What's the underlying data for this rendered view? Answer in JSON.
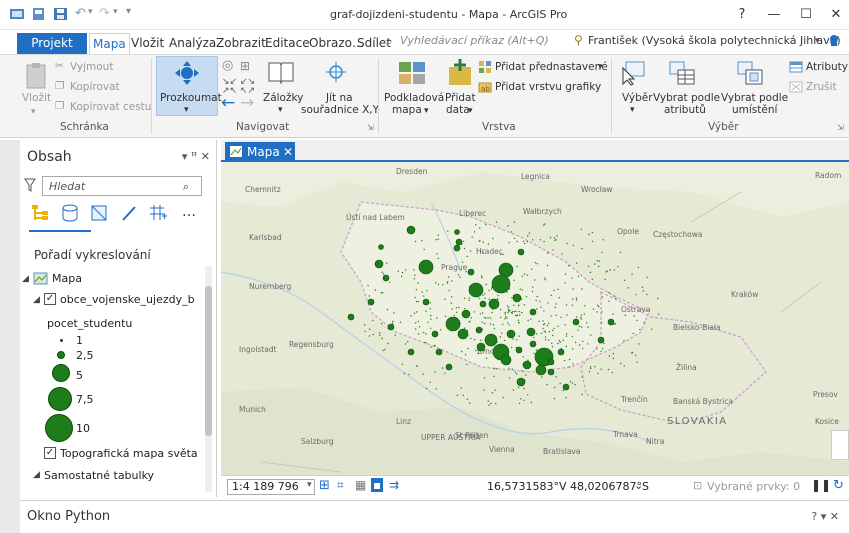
{
  "window": {
    "title": "graf-dojizdeni-studentu - Mapa - ArcGIS Pro",
    "help": "?",
    "minimize": "—",
    "maximize": "☐",
    "close": "✕"
  },
  "tabs": [
    "Projekt",
    "Mapa",
    "Vložit",
    "Analýza",
    "Zobrazit",
    "Editace",
    "Obrazo…",
    "Sdílet"
  ],
  "command_search": {
    "placeholder": "Vyhledávací příkaz (Alt+Q)"
  },
  "user": "František (Vysoká škola polytechnická Jihlava)",
  "ribbon": {
    "clipboard": {
      "paste": "Vložit",
      "cut": "Vyjmout",
      "copy": "Kopírovat",
      "copy_path": "Kopírovat cestu",
      "group": "Schránka"
    },
    "navigate": {
      "explore": "Prozkoumat",
      "bookmarks": "Záložky",
      "goto_xy_1": "Jít na",
      "goto_xy_2": "souřadnice X,Y",
      "group": "Navigovat"
    },
    "layer": {
      "basemap_1": "Podkladová",
      "basemap_2": "mapa",
      "add_data_1": "Přidat",
      "add_data_2": "data",
      "add_preset": "Přidat přednastavené",
      "add_graphics": "Přidat vrstvu grafiky",
      "group": "Vrstva"
    },
    "selection": {
      "select": "Výběr",
      "by_attr_1": "Vybrat podle",
      "by_attr_2": "atributů",
      "by_loc_1": "Vybrat podle",
      "by_loc_2": "umístění",
      "attributes": "Atributy",
      "clear": "Zrušit",
      "group": "Výběr"
    }
  },
  "contents": {
    "title": "Obsah",
    "controls": "▾ ꟸ ✕",
    "search_placeholder": "Hledat",
    "draw_order": "Pořadí vykreslování",
    "map_name": "Mapa",
    "layer_name": "obce_vojenske_ujezdy_b",
    "field": "pocet_studentu",
    "legend": [
      "1",
      "2,5",
      "5",
      "7,5",
      "10"
    ],
    "basemap": "Topografická mapa světa",
    "standalone": "Samostatné tabulky"
  },
  "map_view": {
    "tab": "Mapa",
    "scale": "1:4 189 796",
    "coords": "16,5731583°V 48,0206787°S",
    "selected": "Vybrané prvky: 0",
    "labels": [
      "Dresden",
      "Chemnitz",
      "Legnica",
      "Wrocław",
      "Ústí nad Labem",
      "Liberec",
      "Wałbrzych",
      "Opole",
      "Częstochowa",
      "Karlsbad",
      "Prague",
      "Hradec",
      "Kraków",
      "Nuremberg",
      "Regensburg",
      "Ostrava",
      "Bielsko-Biała",
      "Ingolstadt",
      "Brno",
      "Žilina",
      "Munich",
      "Linz",
      "UPPER AUSTRIA",
      "Trenčín",
      "Banská Bystrica",
      "SLOVAKIA",
      "Salzburg",
      "St Pölten",
      "Vienna",
      "Bratislava",
      "Trnava",
      "Nitra",
      "Presov",
      "Kosice",
      "Radom"
    ]
  },
  "python": {
    "title": "Okno Python",
    "controls": "? ▾ ✕"
  }
}
